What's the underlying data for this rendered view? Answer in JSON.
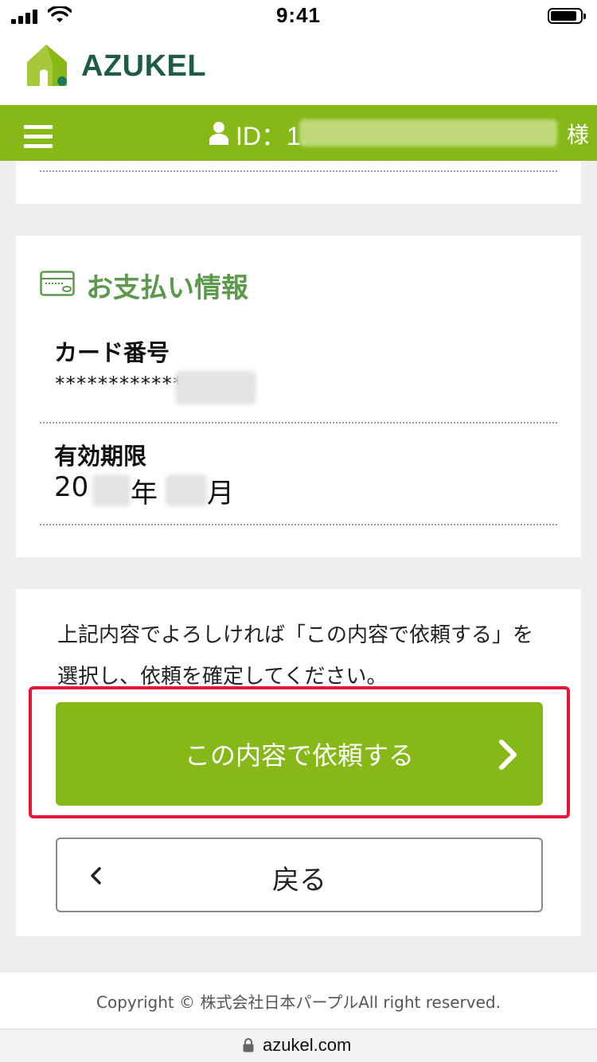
{
  "status_bar": {
    "time": "9:41"
  },
  "brand": {
    "name": "AZUKEL",
    "color": "#86b817",
    "logo_text_color": "#1f5c45"
  },
  "nav": {
    "user_id_label": "ID：1",
    "user_suffix": "様"
  },
  "payment": {
    "section_title": "お支払い情報",
    "card_number_label": "カード番号",
    "card_number_value": "************",
    "expiry_label": "有効期限",
    "expiry_prefix": "20",
    "expiry_year_unit": "年",
    "expiry_month_unit": "月"
  },
  "confirm": {
    "instruction": "上記内容でよろしければ「この内容で依頼する」を選択し、依頼を確定してください。",
    "submit_label": "この内容で依頼する",
    "back_label": "戻る",
    "highlight_color": "#e8153a"
  },
  "footer": {
    "copyright": "Copyright © 株式会社日本パープルAll right reserved."
  },
  "browser": {
    "url": "azukel.com"
  }
}
